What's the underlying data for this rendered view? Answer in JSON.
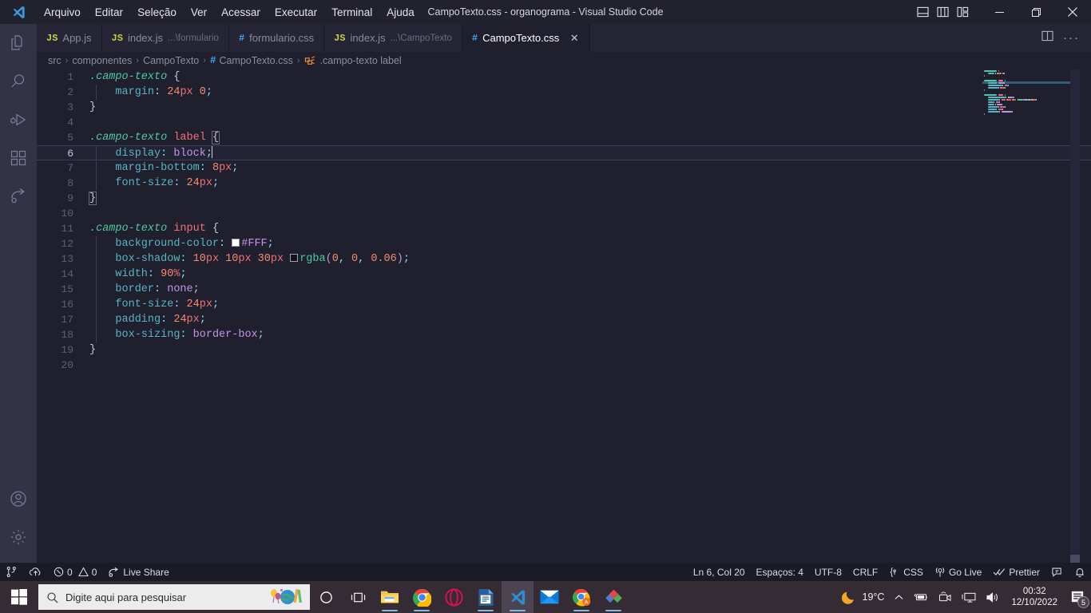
{
  "window": {
    "title": "CampoTexto.css - organograma - Visual Studio Code",
    "menu": [
      "Arquivo",
      "Editar",
      "Seleção",
      "Ver",
      "Acessar",
      "Executar",
      "Terminal",
      "Ajuda"
    ],
    "controls": {
      "minimize": "—",
      "restore": "❐",
      "close": "✕"
    },
    "layout_icons": [
      "panel-layout-icon",
      "sidebar-layout-icon",
      "grid-layout-icon"
    ]
  },
  "activitybar": {
    "items": [
      {
        "name": "explorer",
        "icon": "files-icon",
        "active": true
      },
      {
        "name": "search",
        "icon": "search-icon",
        "active": false
      },
      {
        "name": "run-debug",
        "icon": "run-debug-icon",
        "active": false
      },
      {
        "name": "extensions",
        "icon": "extensions-icon",
        "active": false
      },
      {
        "name": "live-share",
        "icon": "live-share-icon",
        "active": false
      }
    ],
    "bottom": [
      {
        "name": "account",
        "icon": "account-icon"
      },
      {
        "name": "manage",
        "icon": "gear-icon"
      }
    ]
  },
  "tabs": [
    {
      "icon": "JS",
      "icon_type": "js",
      "label": "App.js",
      "sub": "",
      "active": false,
      "close": ""
    },
    {
      "icon": "JS",
      "icon_type": "js",
      "label": "index.js",
      "sub": "...\\formulario",
      "active": false,
      "close": ""
    },
    {
      "icon": "#",
      "icon_type": "css",
      "label": "formulario.css",
      "sub": "",
      "active": false,
      "close": ""
    },
    {
      "icon": "JS",
      "icon_type": "js",
      "label": "index.js",
      "sub": "...\\CampoTexto",
      "active": false,
      "close": ""
    },
    {
      "icon": "#",
      "icon_type": "css",
      "label": "CampoTexto.css",
      "sub": "",
      "active": true,
      "close": "✕"
    }
  ],
  "tabbar_actions": [
    "split-editor-icon",
    "more-actions-icon"
  ],
  "breadcrumb": [
    {
      "label": "src",
      "icon": ""
    },
    {
      "label": "componentes",
      "icon": ""
    },
    {
      "label": "CampoTexto",
      "icon": ""
    },
    {
      "label": "CampoTexto.css",
      "icon": "#"
    },
    {
      "label": ".campo-texto label",
      "icon": "css-selector-icon"
    }
  ],
  "editor": {
    "current_line": 6,
    "lines": [
      {
        "n": 1,
        "indent": false,
        "tokens": [
          {
            "t": ".campo-texto",
            "c": "s-sel"
          },
          {
            "t": " ",
            "c": "s-plain"
          },
          {
            "t": "{",
            "c": "s-brace"
          }
        ]
      },
      {
        "n": 2,
        "indent": true,
        "tokens": [
          {
            "t": "    ",
            "c": "s-plain"
          },
          {
            "t": "margin",
            "c": "s-prop"
          },
          {
            "t": ":",
            "c": "s-punc"
          },
          {
            "t": " ",
            "c": "s-plain"
          },
          {
            "t": "24",
            "c": "s-num"
          },
          {
            "t": "px",
            "c": "s-unit"
          },
          {
            "t": " ",
            "c": "s-plain"
          },
          {
            "t": "0",
            "c": "s-num"
          },
          {
            "t": ";",
            "c": "s-punc"
          }
        ]
      },
      {
        "n": 3,
        "indent": false,
        "tokens": [
          {
            "t": "}",
            "c": "s-brace"
          }
        ]
      },
      {
        "n": 4,
        "indent": false,
        "tokens": []
      },
      {
        "n": 5,
        "indent": false,
        "tokens": [
          {
            "t": ".campo-texto",
            "c": "s-sel"
          },
          {
            "t": " ",
            "c": "s-plain"
          },
          {
            "t": "label",
            "c": "s-tag"
          },
          {
            "t": " ",
            "c": "s-plain"
          },
          {
            "t": "{",
            "c": "s-brace brace-match"
          }
        ]
      },
      {
        "n": 6,
        "indent": true,
        "tokens": [
          {
            "t": "    ",
            "c": "s-plain"
          },
          {
            "t": "display",
            "c": "s-prop"
          },
          {
            "t": ":",
            "c": "s-punc"
          },
          {
            "t": " ",
            "c": "s-plain"
          },
          {
            "t": "block",
            "c": "s-val"
          },
          {
            "t": ";",
            "c": "s-punc"
          }
        ],
        "cursor": true
      },
      {
        "n": 7,
        "indent": true,
        "tokens": [
          {
            "t": "    ",
            "c": "s-plain"
          },
          {
            "t": "margin-bottom",
            "c": "s-prop"
          },
          {
            "t": ":",
            "c": "s-punc"
          },
          {
            "t": " ",
            "c": "s-plain"
          },
          {
            "t": "8",
            "c": "s-num"
          },
          {
            "t": "px",
            "c": "s-unit"
          },
          {
            "t": ";",
            "c": "s-punc"
          }
        ]
      },
      {
        "n": 8,
        "indent": true,
        "tokens": [
          {
            "t": "    ",
            "c": "s-plain"
          },
          {
            "t": "font-size",
            "c": "s-prop"
          },
          {
            "t": ":",
            "c": "s-punc"
          },
          {
            "t": " ",
            "c": "s-plain"
          },
          {
            "t": "24",
            "c": "s-num"
          },
          {
            "t": "px",
            "c": "s-unit"
          },
          {
            "t": ";",
            "c": "s-punc"
          }
        ]
      },
      {
        "n": 9,
        "indent": false,
        "tokens": [
          {
            "t": "}",
            "c": "s-brace brace-match"
          }
        ]
      },
      {
        "n": 10,
        "indent": false,
        "tokens": []
      },
      {
        "n": 11,
        "indent": false,
        "tokens": [
          {
            "t": ".campo-texto",
            "c": "s-sel"
          },
          {
            "t": " ",
            "c": "s-plain"
          },
          {
            "t": "input",
            "c": "s-tag"
          },
          {
            "t": " ",
            "c": "s-plain"
          },
          {
            "t": "{",
            "c": "s-brace"
          }
        ]
      },
      {
        "n": 12,
        "indent": true,
        "tokens": [
          {
            "t": "    ",
            "c": "s-plain"
          },
          {
            "t": "background-color",
            "c": "s-prop"
          },
          {
            "t": ":",
            "c": "s-punc"
          },
          {
            "t": " ",
            "c": "s-plain"
          },
          {
            "t": "",
            "c": "swatch",
            "swatch": "#FFFFFF"
          },
          {
            "t": "#FFF",
            "c": "s-val"
          },
          {
            "t": ";",
            "c": "s-punc"
          }
        ]
      },
      {
        "n": 13,
        "indent": true,
        "tokens": [
          {
            "t": "    ",
            "c": "s-plain"
          },
          {
            "t": "box-shadow",
            "c": "s-prop"
          },
          {
            "t": ":",
            "c": "s-punc"
          },
          {
            "t": " ",
            "c": "s-plain"
          },
          {
            "t": "10",
            "c": "s-num"
          },
          {
            "t": "px",
            "c": "s-unit"
          },
          {
            "t": " ",
            "c": "s-plain"
          },
          {
            "t": "10",
            "c": "s-num"
          },
          {
            "t": "px",
            "c": "s-unit"
          },
          {
            "t": " ",
            "c": "s-plain"
          },
          {
            "t": "30",
            "c": "s-num"
          },
          {
            "t": "px",
            "c": "s-unit"
          },
          {
            "t": " ",
            "c": "s-plain"
          },
          {
            "t": "",
            "c": "swatch",
            "swatch": "#111118"
          },
          {
            "t": "rgba",
            "c": "s-func"
          },
          {
            "t": "(",
            "c": "s-paren"
          },
          {
            "t": "0",
            "c": "s-num"
          },
          {
            "t": ", ",
            "c": "s-punc"
          },
          {
            "t": "0",
            "c": "s-num"
          },
          {
            "t": ", ",
            "c": "s-punc"
          },
          {
            "t": "0.06",
            "c": "s-num"
          },
          {
            "t": ")",
            "c": "s-paren"
          },
          {
            "t": ";",
            "c": "s-punc"
          }
        ]
      },
      {
        "n": 14,
        "indent": true,
        "tokens": [
          {
            "t": "    ",
            "c": "s-plain"
          },
          {
            "t": "width",
            "c": "s-prop"
          },
          {
            "t": ":",
            "c": "s-punc"
          },
          {
            "t": " ",
            "c": "s-plain"
          },
          {
            "t": "90",
            "c": "s-num"
          },
          {
            "t": "%",
            "c": "s-unit"
          },
          {
            "t": ";",
            "c": "s-punc"
          }
        ]
      },
      {
        "n": 15,
        "indent": true,
        "tokens": [
          {
            "t": "    ",
            "c": "s-plain"
          },
          {
            "t": "border",
            "c": "s-prop"
          },
          {
            "t": ":",
            "c": "s-punc"
          },
          {
            "t": " ",
            "c": "s-plain"
          },
          {
            "t": "none",
            "c": "s-val"
          },
          {
            "t": ";",
            "c": "s-punc"
          }
        ]
      },
      {
        "n": 16,
        "indent": true,
        "tokens": [
          {
            "t": "    ",
            "c": "s-plain"
          },
          {
            "t": "font-size",
            "c": "s-prop"
          },
          {
            "t": ":",
            "c": "s-punc"
          },
          {
            "t": " ",
            "c": "s-plain"
          },
          {
            "t": "24",
            "c": "s-num"
          },
          {
            "t": "px",
            "c": "s-unit"
          },
          {
            "t": ";",
            "c": "s-punc"
          }
        ]
      },
      {
        "n": 17,
        "indent": true,
        "tokens": [
          {
            "t": "    ",
            "c": "s-plain"
          },
          {
            "t": "padding",
            "c": "s-prop"
          },
          {
            "t": ":",
            "c": "s-punc"
          },
          {
            "t": " ",
            "c": "s-plain"
          },
          {
            "t": "24",
            "c": "s-num"
          },
          {
            "t": "px",
            "c": "s-unit"
          },
          {
            "t": ";",
            "c": "s-punc"
          }
        ]
      },
      {
        "n": 18,
        "indent": true,
        "tokens": [
          {
            "t": "    ",
            "c": "s-plain"
          },
          {
            "t": "box-sizing",
            "c": "s-prop"
          },
          {
            "t": ":",
            "c": "s-punc"
          },
          {
            "t": " ",
            "c": "s-plain"
          },
          {
            "t": "border-box",
            "c": "s-val"
          },
          {
            "t": ";",
            "c": "s-punc"
          }
        ]
      },
      {
        "n": 19,
        "indent": false,
        "tokens": [
          {
            "t": "}",
            "c": "s-brace"
          }
        ]
      },
      {
        "n": 20,
        "indent": false,
        "tokens": []
      }
    ]
  },
  "statusbar": {
    "left": [
      {
        "name": "remote",
        "icon": "remote-icon",
        "label": ""
      },
      {
        "name": "source-control-sync",
        "icon": "cloud-sync-icon",
        "label": ""
      },
      {
        "name": "problems",
        "icon": "error-warning-icon",
        "label": "0  0",
        "errors": "0",
        "warnings": "0"
      },
      {
        "name": "live-share",
        "icon": "live-share-icon",
        "label": "Live Share"
      }
    ],
    "right": [
      {
        "name": "cursor-position",
        "label": "Ln 6, Col 20"
      },
      {
        "name": "indentation",
        "label": "Espaços: 4"
      },
      {
        "name": "encoding",
        "label": "UTF-8"
      },
      {
        "name": "eol",
        "label": "CRLF"
      },
      {
        "name": "language-mode",
        "label": "CSS",
        "icon": "css-icon"
      },
      {
        "name": "go-live",
        "label": "Go Live",
        "icon": "broadcast-icon"
      },
      {
        "name": "prettier",
        "label": "Prettier",
        "icon": "check-check-icon"
      },
      {
        "name": "feedback",
        "label": "",
        "icon": "feedback-icon"
      },
      {
        "name": "notifications",
        "label": "",
        "icon": "bell-icon"
      }
    ]
  },
  "taskbar": {
    "start": "windows-logo-icon",
    "search": {
      "placeholder": "Digite aqui para pesquisar",
      "icon": "search-icon"
    },
    "icons": [
      {
        "name": "cortana",
        "icon": "circle-icon",
        "running": false,
        "active": false
      },
      {
        "name": "task-view",
        "icon": "task-view-icon",
        "running": false,
        "active": false
      },
      {
        "name": "file-explorer",
        "icon": "folder-icon",
        "running": true,
        "active": false
      },
      {
        "name": "google-chrome",
        "icon": "chrome-icon",
        "running": true,
        "active": false
      },
      {
        "name": "opera",
        "icon": "opera-icon",
        "running": false,
        "active": false
      },
      {
        "name": "libreoffice-writer",
        "icon": "document-icon",
        "running": true,
        "active": false
      },
      {
        "name": "visual-studio-code",
        "icon": "vscode-icon",
        "running": true,
        "active": true
      },
      {
        "name": "mail",
        "icon": "mail-icon",
        "running": false,
        "active": false
      },
      {
        "name": "chrome-profile",
        "icon": "chrome-profile-icon",
        "running": true,
        "active": false
      },
      {
        "name": "paint-3d",
        "icon": "paint-icon",
        "running": true,
        "active": false
      }
    ],
    "tray": {
      "weather": {
        "icon": "moon-icon",
        "temp": "19°C"
      },
      "chevron": "chevron-up-icon",
      "icons": [
        "battery-icon",
        "camera-icon",
        "display-icon",
        "volume-icon"
      ],
      "time": "00:32",
      "date": "12/10/2022",
      "notifications": {
        "icon": "notification-icon",
        "count": "5"
      }
    }
  }
}
